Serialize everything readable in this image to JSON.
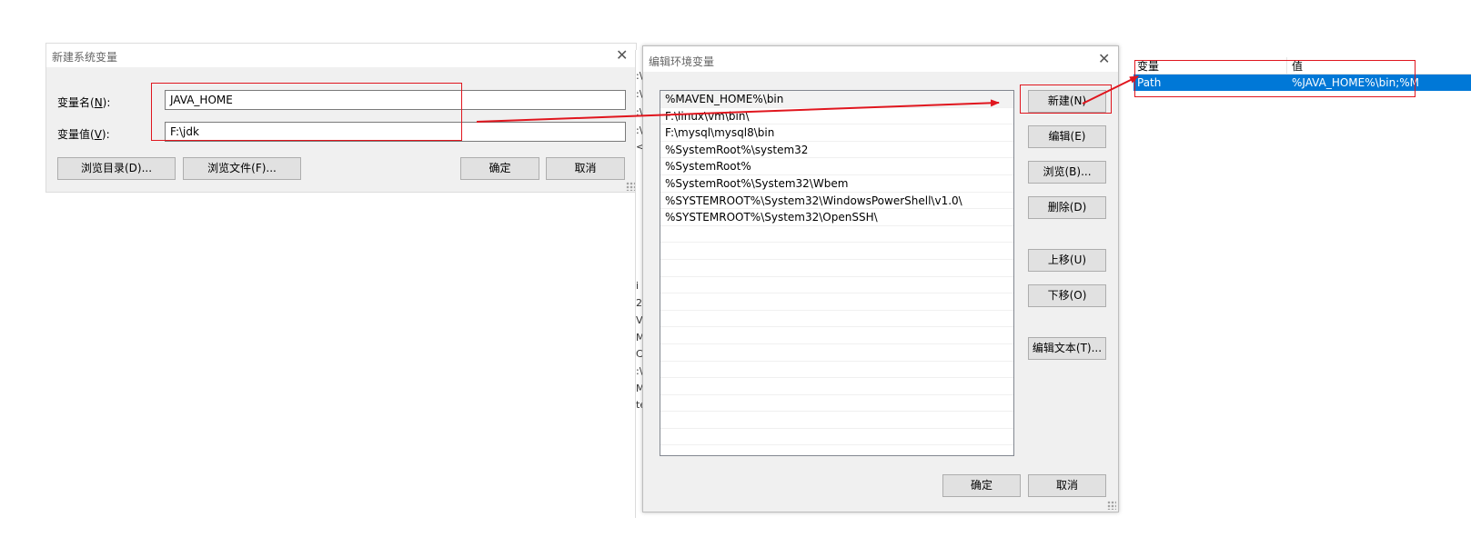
{
  "new_var_dialog": {
    "title": "新建系统变量",
    "name_label_prefix": "变量名(",
    "name_label_key": "N",
    "name_label_suffix": "):",
    "value_label_prefix": "变量值(",
    "value_label_key": "V",
    "value_label_suffix": "):",
    "name_value": "JAVA_HOME",
    "value_value": "F:\\jdk",
    "browse_dir_label": "浏览目录(D)...",
    "browse_file_label": "浏览文件(F)...",
    "ok_label": "确定",
    "cancel_label": "取消"
  },
  "edit_env_dialog": {
    "title": "编辑环境变量",
    "paths": [
      "%MAVEN_HOME%\\bin",
      "F:\\linux\\vm\\bin\\",
      "F:\\mysql\\mysql8\\bin",
      "%SystemRoot%\\system32",
      "%SystemRoot%",
      "%SystemRoot%\\System32\\Wbem",
      "%SYSTEMROOT%\\System32\\WindowsPowerShell\\v1.0\\",
      "%SYSTEMROOT%\\System32\\OpenSSH\\",
      "",
      "",
      "",
      "",
      "",
      "",
      "",
      "",
      "",
      "",
      "",
      "",
      "",
      ""
    ],
    "buttons": {
      "new": "新建(N)",
      "edit": "编辑(E)",
      "browse": "浏览(B)...",
      "delete": "删除(D)",
      "move_up": "上移(U)",
      "move_down": "下移(O)",
      "edit_text": "编辑文本(T)...",
      "ok": "确定",
      "cancel": "取消"
    }
  },
  "variables_table": {
    "col_name": "变量",
    "col_value": "值",
    "selected_row": {
      "name": "Path",
      "value": "%JAVA_HOME%\\bin;%M"
    }
  },
  "bg_strip_chars": [
    ":\\",
    ":\\",
    ":\\",
    ":\\",
    "<-",
    "i",
    "2",
    "Vi",
    "M",
    "C",
    ":\\",
    "M",
    "te"
  ],
  "colors": {
    "highlight_red": "#e0161e",
    "selection_blue": "#0078d7"
  }
}
